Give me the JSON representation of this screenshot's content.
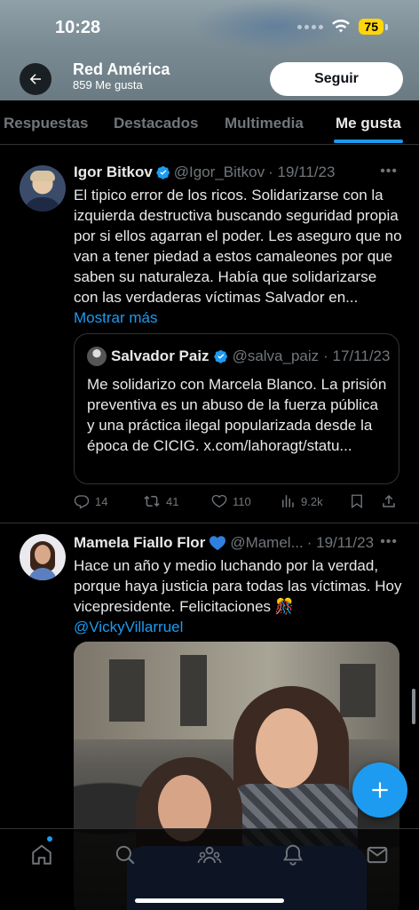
{
  "status": {
    "time": "10:28",
    "battery": "75"
  },
  "profile": {
    "name": "Red América",
    "likes": "859 Me gusta",
    "follow_label": "Seguir"
  },
  "tabs": [
    {
      "label": "Respuestas",
      "active": false
    },
    {
      "label": "Destacados",
      "active": false
    },
    {
      "label": "Multimedia",
      "active": false
    },
    {
      "label": "Me gusta",
      "active": true
    }
  ],
  "tweets": [
    {
      "name": "Igor Bitkov",
      "handle": "@Igor_Bitkov",
      "date": "· 19/11/23",
      "text": "El tipico error de los ricos.  Solidarizarse con la izquierda destructiva buscando seguridad propia por si ellos agarran el poder. Les aseguro que no van a tener piedad a estos camaleones por que saben su naturaleza. Había que solidarizarse con las verdaderas víctimas Salvador en... ",
      "show_more": "Mostrar más",
      "quote": {
        "name": "Salvador Paiz",
        "handle": "@salva_paiz",
        "date": "· 17/11/23",
        "text": "Me solidarizo con Marcela Blanco. La prisión preventiva es un abuso de la fuerza pública y una práctica ilegal popularizada desde la época de CICIG. x.com/lahoragt/statu..."
      },
      "stats": {
        "replies": "14",
        "reposts": "41",
        "likes": "110",
        "views": "9.2k"
      }
    },
    {
      "name": "Mamela Fiallo Flor",
      "handle": "@Mamel...",
      "date": "· 19/11/23",
      "text": "Hace un año y medio luchando por la verdad, porque haya justicia para todas las víctimas. Hoy vicepresidente. Felicitaciones ",
      "emoji": "🎊",
      "mention": "@VickyVillarruel"
    }
  ],
  "colors": {
    "accent": "#1d9bf0",
    "background": "#000000",
    "muted": "#71767b",
    "text": "#e7e9ea",
    "battery": "#ffd60a"
  },
  "icons": [
    "back-arrow-icon",
    "verified-badge-icon",
    "reply-icon",
    "repost-icon",
    "like-icon",
    "views-icon",
    "bookmark-icon",
    "share-icon",
    "compose-plus-icon",
    "home-icon",
    "search-icon",
    "communities-icon",
    "notifications-icon",
    "messages-icon"
  ]
}
